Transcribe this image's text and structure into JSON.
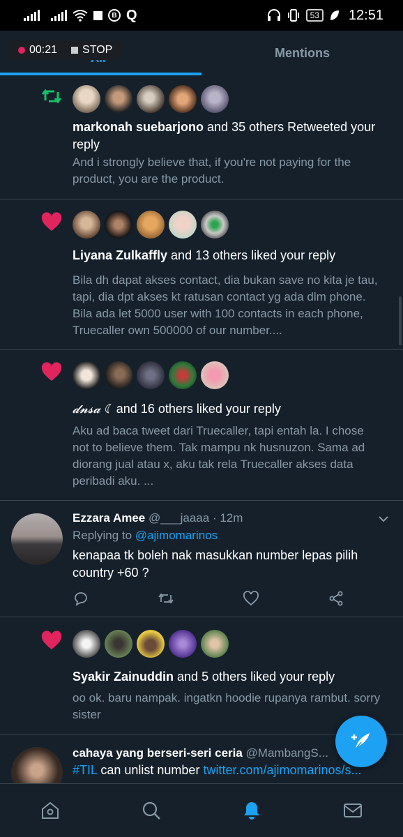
{
  "status_bar": {
    "time": "12:51",
    "battery": "53"
  },
  "recorder": {
    "elapsed": "00:21",
    "stop_label": "STOP"
  },
  "tabs": {
    "all_label": "All",
    "mentions_label": "Mentions"
  },
  "notifications": [
    {
      "type": "retweet",
      "actor": "markonah suebarjono",
      "action": " and 35 others Retweeted your reply",
      "snippet": "And i strongly believe that, if you're not paying for the product, you are the product."
    },
    {
      "type": "like",
      "actor": "Liyana Zulkaffly",
      "action": " and 13 others liked your reply",
      "snippet": "Bila dh dapat akses contact, dia bukan save no kita je tau, tapi, dia dpt akses kt ratusan contact yg ada dlm phone. Bila ada let 5000 user with 100 contacts in each phone, Truecaller own 500000 of our number...."
    },
    {
      "type": "like",
      "actor": "𝓭𝓷𝓼𝓪 ☾",
      "action": " and 16 others liked your reply",
      "snippet": "Aku ad baca tweet dari Truecaller, tapi entah la. I chose not to believe them. Tak mampu nk husnuzon. Sama ad diorang jual atau x, aku tak rela Truecaller akses data peribadi aku. ..."
    }
  ],
  "reply_tweet": {
    "name": "Ezzara Amee",
    "handle": "@___jaaaa",
    "time": " · 12m",
    "replying_prefix": "Replying to ",
    "replying_to": "@ajimomarinos",
    "text": "kenapaa tk boleh nak masukkan number lepas pilih country +60 ?"
  },
  "notification_4": {
    "actor": "Syakir Zainuddin",
    "action": " and 5 others liked your reply",
    "snippet": "oo ok. baru nampak. ingatkn hoodie rupanya rambut. sorry sister"
  },
  "last_tweet": {
    "name": "cahaya yang berseri-seri ceria",
    "handle": " @MambangS...",
    "hashtag": "#TIL",
    "text_mid": " can unlist number ",
    "link": "twitter.com/ajimomarinos/s..."
  },
  "colors": {
    "background": "#15202b",
    "accent": "#1da1f2",
    "like": "#e0245e",
    "retweet": "#17bf63",
    "muted": "#8899a6"
  },
  "icons": {
    "nav": [
      "home-icon",
      "search-icon",
      "notifications-icon",
      "messages-icon"
    ],
    "fab": "compose-tweet-icon"
  }
}
